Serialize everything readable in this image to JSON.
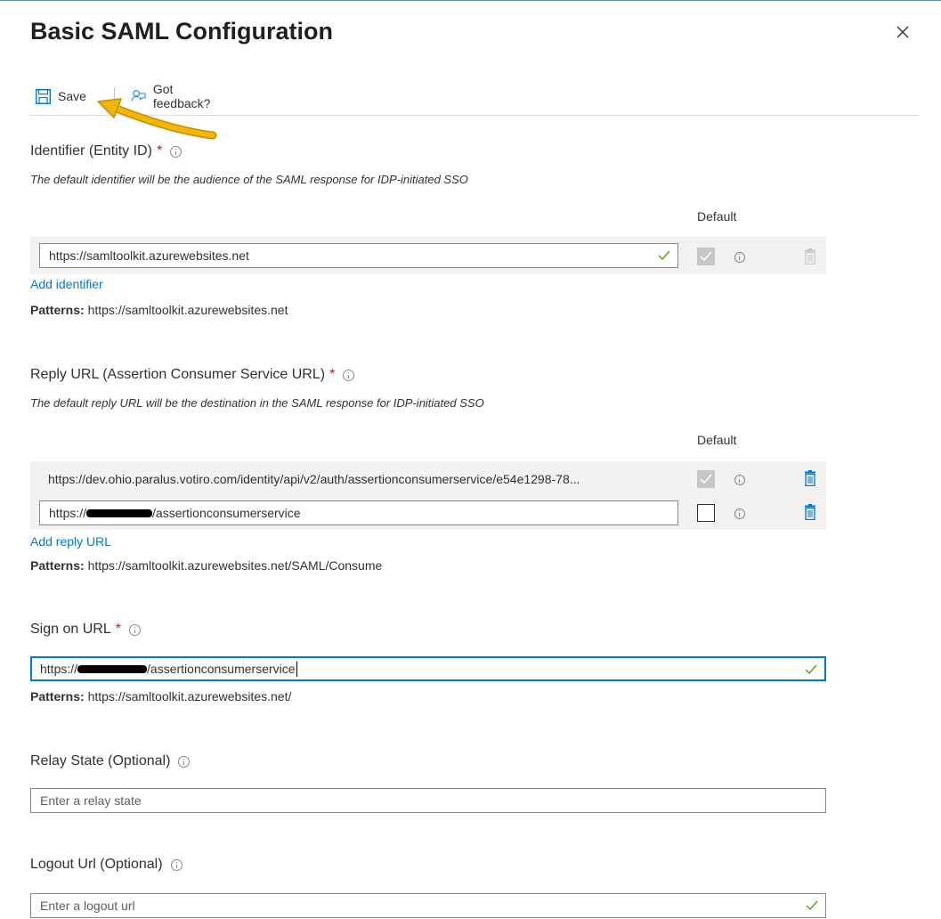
{
  "panel": {
    "title": "Basic SAML Configuration"
  },
  "toolbar": {
    "save_label": "Save",
    "feedback_label": "Got feedback?"
  },
  "identifier": {
    "label": "Identifier (Entity ID)",
    "required_mark": "*",
    "description": "The default identifier will be the audience of the SAML response for IDP-initiated SSO",
    "default_header": "Default",
    "rows": [
      {
        "value": "https://samltoolkit.azurewebsites.net",
        "default_checked": true,
        "default_disabled": true
      }
    ],
    "add_link": "Add identifier",
    "patterns_label": "Patterns:",
    "patterns_value": "https://samltoolkit.azurewebsites.net"
  },
  "reply_url": {
    "label": "Reply URL (Assertion Consumer Service URL)",
    "required_mark": "*",
    "description": "The default reply URL will be the destination in the SAML response for IDP-initiated SSO",
    "default_header": "Default",
    "rows": [
      {
        "value": "https://dev.ohio.paralus.votiro.com/identity/api/v2/auth/assertionconsumerservice/e54e1298-78...",
        "default_checked": true,
        "default_disabled": true
      },
      {
        "value_prefix": "https://",
        "value_suffix": "/assertionconsumerservice",
        "default_checked": false
      }
    ],
    "add_link": "Add reply URL",
    "patterns_label": "Patterns:",
    "patterns_value": "https://samltoolkit.azurewebsites.net/SAML/Consume"
  },
  "sign_on": {
    "label": "Sign on URL",
    "required_mark": "*",
    "value_prefix": "https://",
    "value_suffix": "/assertionconsumerservice",
    "patterns_label": "Patterns:",
    "patterns_value": "https://samltoolkit.azurewebsites.net/"
  },
  "relay_state": {
    "label": "Relay State (Optional)",
    "placeholder": "Enter a relay state"
  },
  "logout_url": {
    "label": "Logout Url (Optional)",
    "placeholder": "Enter a logout url"
  },
  "colors": {
    "accent": "#0078d4",
    "required": "#a4262c",
    "valid_check": "#57a300",
    "arrow": "#f2b705"
  }
}
